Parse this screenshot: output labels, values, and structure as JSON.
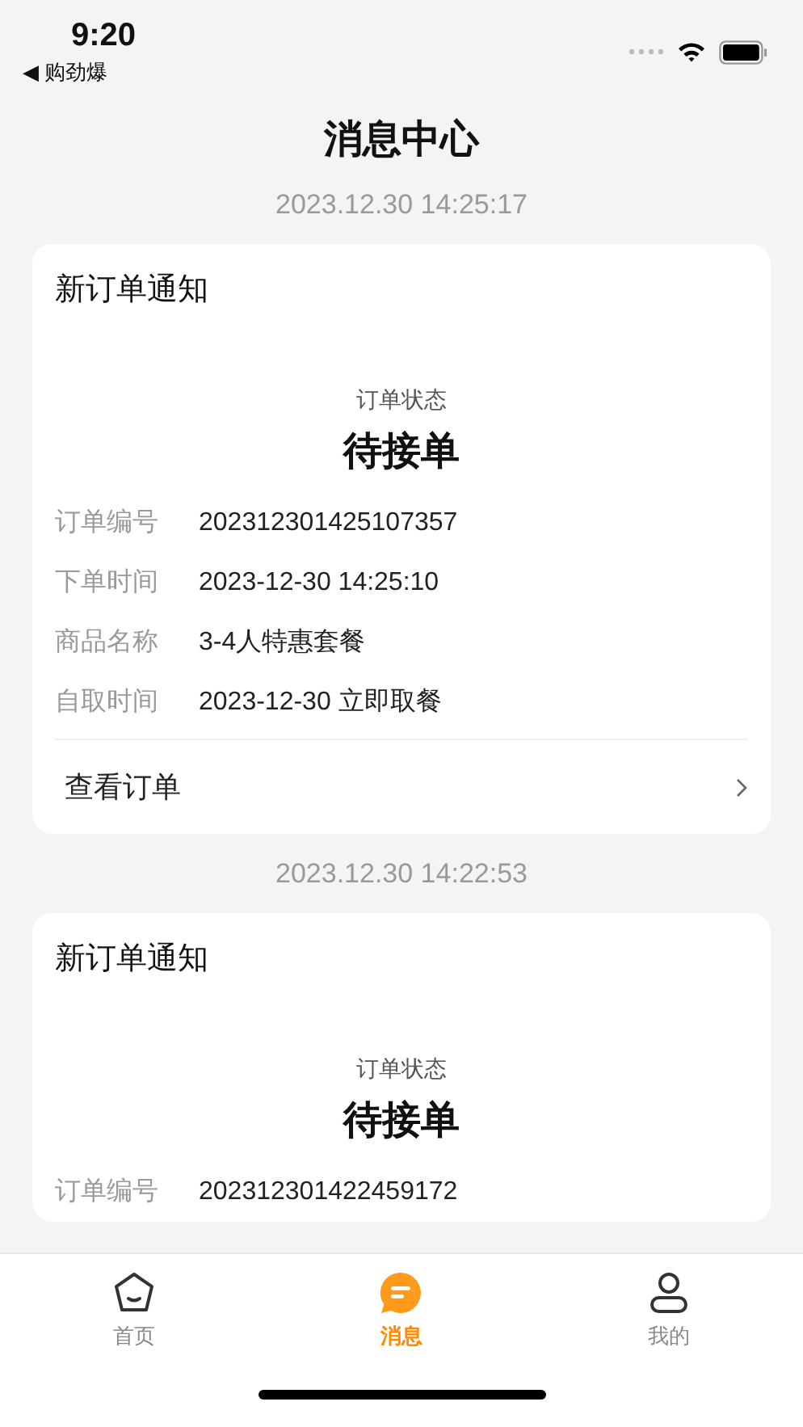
{
  "status_bar": {
    "time": "9:20",
    "back_label": "◀ 购劲爆"
  },
  "title": "消息中心",
  "messages": [
    {
      "timestamp": "2023.12.30 14:25:17",
      "title": "新订单通知",
      "status_label": "订单状态",
      "status": "待接单",
      "fields": [
        {
          "label": "订单编号",
          "value": "202312301425107357"
        },
        {
          "label": "下单时间",
          "value": "2023-12-30 14:25:10"
        },
        {
          "label": "商品名称",
          "value": "3-4人特惠套餐"
        },
        {
          "label": "自取时间",
          "value": "2023-12-30 立即取餐"
        }
      ],
      "action": "查看订单"
    },
    {
      "timestamp": "2023.12.30 14:22:53",
      "title": "新订单通知",
      "status_label": "订单状态",
      "status": "待接单",
      "fields": [
        {
          "label": "订单编号",
          "value": "202312301422459172"
        }
      ]
    }
  ],
  "tabs": [
    {
      "kind": "home",
      "label": "首页",
      "selected": false
    },
    {
      "kind": "message",
      "label": "消息",
      "selected": true
    },
    {
      "kind": "profile",
      "label": "我的",
      "selected": false
    }
  ]
}
